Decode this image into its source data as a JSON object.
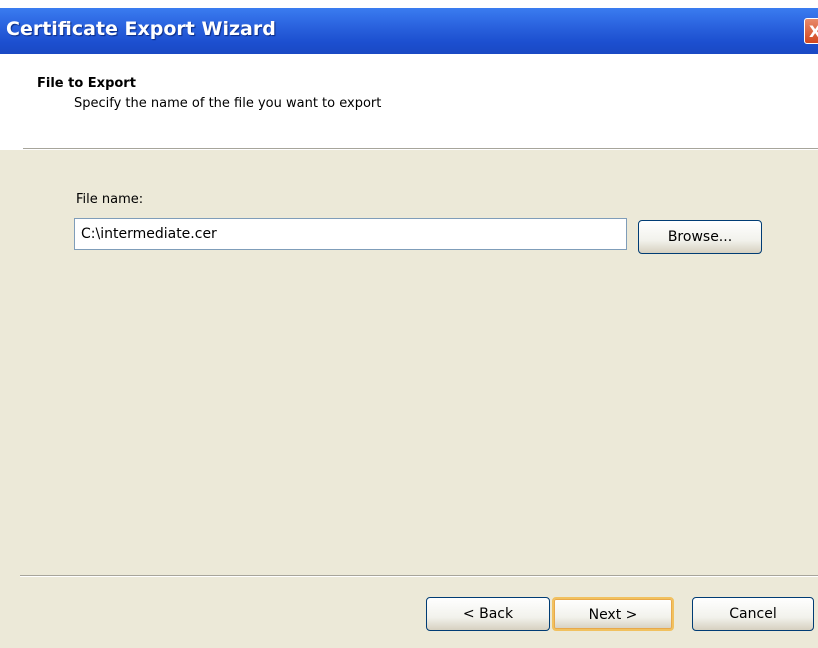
{
  "window": {
    "title": "Certificate Export Wizard",
    "close_label": "X"
  },
  "header": {
    "title": "File to Export",
    "subtitle": "Specify the name of the file you want to export"
  },
  "form": {
    "file_name_label": "File name:",
    "file_name_value": "C:\\intermediate.cer",
    "browse_label": "Browse..."
  },
  "footer": {
    "back_label": "< Back",
    "next_label": "Next >",
    "cancel_label": "Cancel"
  }
}
